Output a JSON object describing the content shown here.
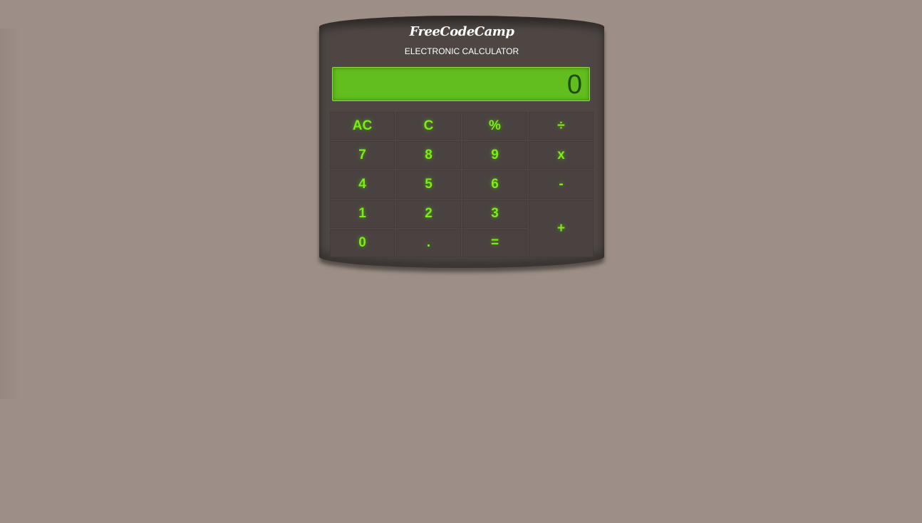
{
  "calculator": {
    "brand": "FreeCodeCamp",
    "subtitle": "ELECTRONIC CALCULATOR",
    "display": "0"
  },
  "keys": {
    "ac": "AC",
    "c": "C",
    "percent": "%",
    "divide": "÷",
    "seven": "7",
    "eight": "8",
    "nine": "9",
    "multiply": "x",
    "four": "4",
    "five": "5",
    "six": "6",
    "minus": "-",
    "one": "1",
    "two": "2",
    "three": "3",
    "plus": "+",
    "zero": "0",
    "dot": ".",
    "equals": "="
  },
  "colors": {
    "background": "#9d8f87",
    "body": "#4e4643",
    "display": "#62bd1e",
    "display_text": "#1f4d08",
    "key_text": "#76f010"
  }
}
